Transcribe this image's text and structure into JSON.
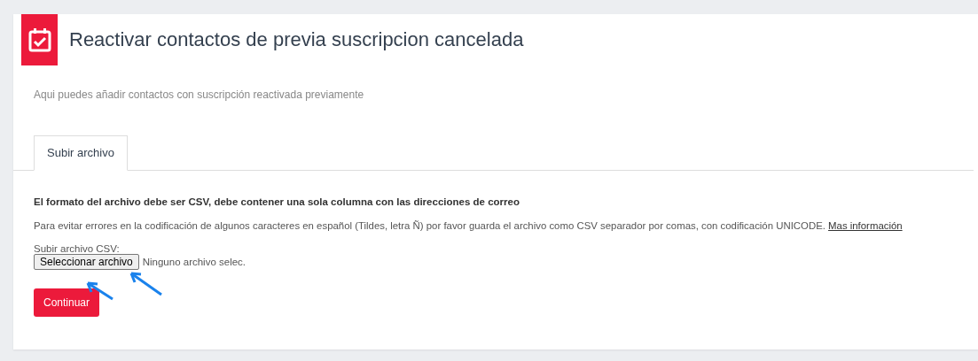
{
  "header": {
    "title": "Reactivar contactos de previa suscripcion cancelada",
    "subtitle": "Aqui puedes añadir contactos con suscripción reactivada previamente"
  },
  "tabs": [
    {
      "label": "Subir archivo",
      "selected": true
    }
  ],
  "notice": "El formato del archivo debe ser CSV, debe contener una sola columna con las direcciones de correo",
  "info": {
    "text": "Para evitar errores en la codificación de algunos caracteres en español (Tildes, letra Ñ) por favor guarda el archivo como CSV separador por comas, con codificación UNICODE.",
    "link": "Mas información"
  },
  "upload": {
    "label": "Subir archivo CSV:",
    "button": "Seleccionar archivo",
    "status": "Ninguno archivo selec."
  },
  "submit": "Continuar"
}
